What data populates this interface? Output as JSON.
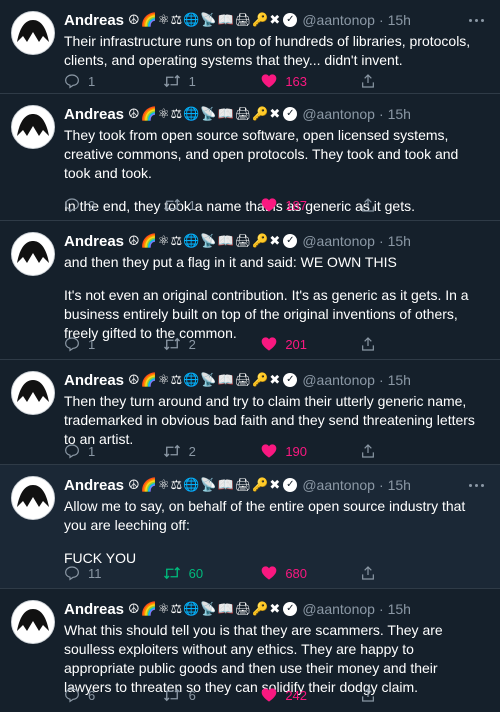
{
  "user": {
    "name": "Andreas",
    "emoji": "☮🌈⚛⚖🌐📡📖🖨🔑✖",
    "handle": "@aantonop"
  },
  "colors": {
    "background": "#15202b",
    "like": "#f91880",
    "retweet_active": "#00ba7c",
    "muted": "#8b98a5"
  },
  "tweets": [
    {
      "time": "15h",
      "paragraphs": [
        "Their infrastructure runs on top of hundreds of libraries, protocols, clients, and operating systems that they... didn't invent."
      ],
      "replies": "1",
      "retweets": "1",
      "likes": "163"
    },
    {
      "time": "15h",
      "paragraphs": [
        "They took from open source software, open licensed systems, creative commons, and open protocols. They took and took and took and took.",
        "In the end, they took a name that is as generic as it gets."
      ],
      "replies": "2",
      "retweets": "1",
      "likes": "187"
    },
    {
      "time": "15h",
      "paragraphs": [
        "and then they put a flag in it and said: WE OWN THIS",
        "It's not even an original contribution. It's as generic as it gets. In a business entirely built on top of the original inventions of others, freely gifted to the common."
      ],
      "replies": "1",
      "retweets": "2",
      "likes": "201"
    },
    {
      "time": "15h",
      "paragraphs": [
        "Then they turn around and try to claim their utterly generic name, trademarked in obvious bad faith and they send threatening letters to an artist."
      ],
      "replies": "1",
      "retweets": "2",
      "likes": "190"
    },
    {
      "time": "15h",
      "paragraphs": [
        "Allow me to say, on behalf of the entire open source industry that you are leeching off:",
        "FUCK YOU"
      ],
      "replies": "11",
      "retweets": "60",
      "likes": "680"
    },
    {
      "time": "15h",
      "paragraphs": [
        "What this should tell you is that they are scammers. They are soulless exploiters without any ethics. They are happy to appropriate public goods and then use their money and their lawyers to threaten so they can solidify their dodgy claim."
      ],
      "replies": "6",
      "retweets": "6",
      "likes": "242"
    }
  ]
}
